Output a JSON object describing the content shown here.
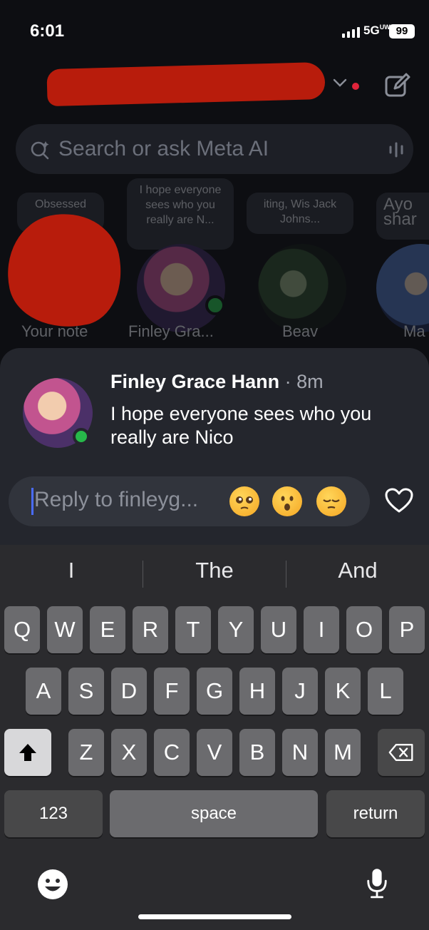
{
  "status_bar": {
    "time": "6:01",
    "network": "5G",
    "network_sub": "UW",
    "battery": "99"
  },
  "search": {
    "placeholder": "Search or ask Meta AI"
  },
  "notes": [
    {
      "name": "Your note",
      "bubble": "Obsessed wi..."
    },
    {
      "name": "Finley Gra...",
      "bubble": "I hope everyone sees who you really are N..."
    },
    {
      "name": "Beav",
      "bubble": "iting, Wis Jack Johns..."
    },
    {
      "name": "Ma",
      "bubble": "Ayo shar"
    }
  ],
  "reply_sheet": {
    "sender": "Finley Grace Hann",
    "separator": "·",
    "time_ago": "8m",
    "message": "I hope everyone sees who you really are Nico",
    "reply_placeholder": "Reply to finleyg...",
    "quick_reactions": [
      "pleading-face",
      "astonished-face",
      "pensive-face"
    ]
  },
  "keyboard": {
    "suggestions": [
      "I",
      "The",
      "And"
    ],
    "row1": [
      "Q",
      "W",
      "E",
      "R",
      "T",
      "Y",
      "U",
      "I",
      "O",
      "P"
    ],
    "row2": [
      "A",
      "S",
      "D",
      "F",
      "G",
      "H",
      "J",
      "K",
      "L"
    ],
    "row3": [
      "Z",
      "X",
      "C",
      "V",
      "B",
      "N",
      "M"
    ],
    "numbers_key": "123",
    "space_key": "space",
    "return_key": "return"
  },
  "colors": {
    "accent_blue": "#4a6cff",
    "online_green": "#27b84a",
    "redaction": "#b81c0c"
  }
}
